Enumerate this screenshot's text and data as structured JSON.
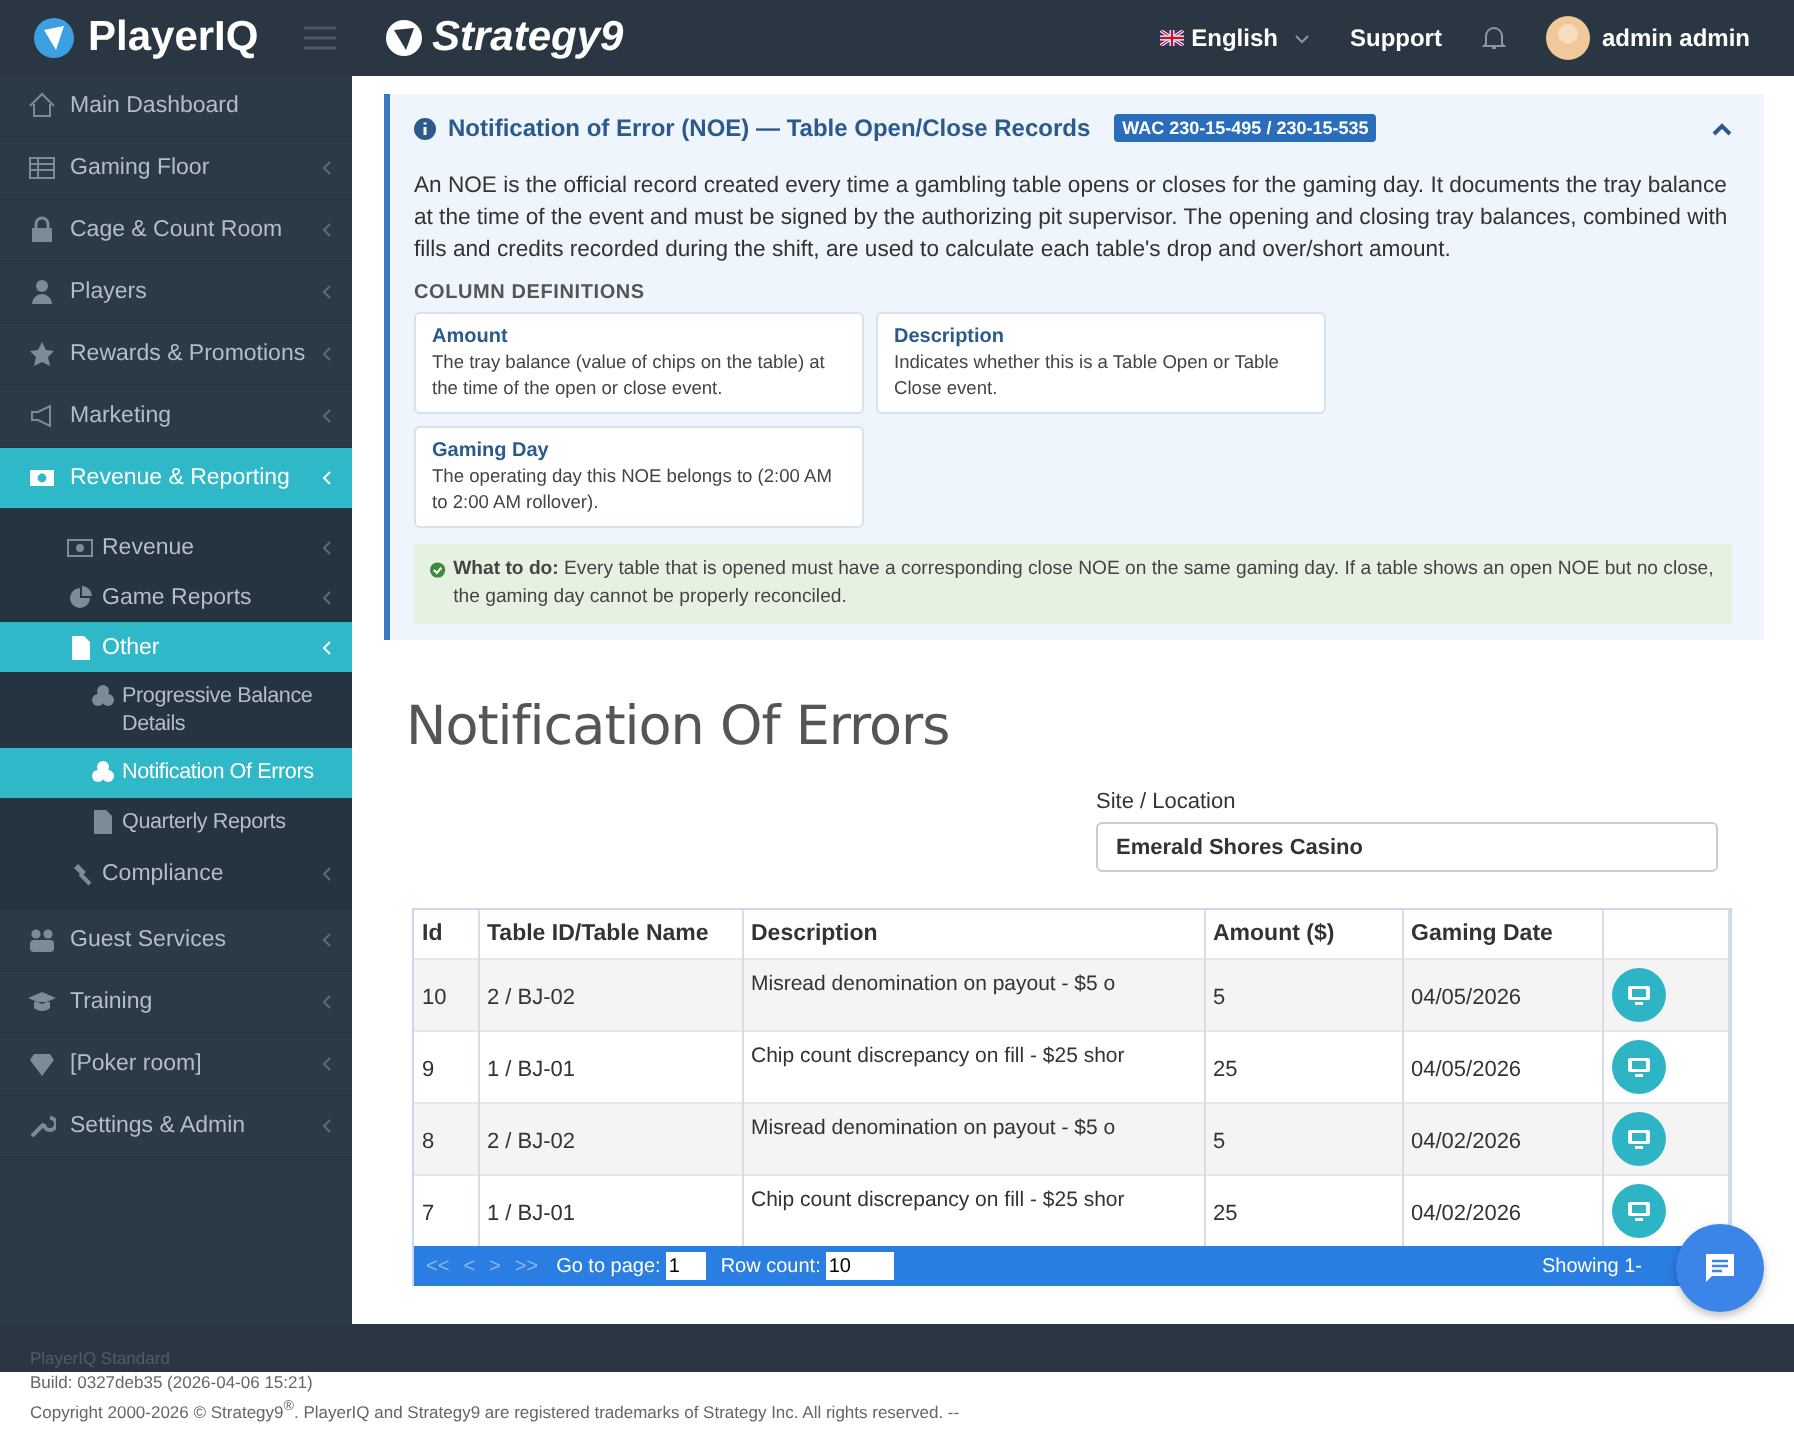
{
  "header": {
    "brand": "PlayerIQ",
    "company": "Strategy9",
    "language": "English",
    "support": "Support",
    "user": "admin admin"
  },
  "sidebar": {
    "items": [
      {
        "label": "Main Dashboard",
        "selected": false,
        "expandable": false
      },
      {
        "label": "Gaming Floor",
        "selected": false,
        "expandable": true
      },
      {
        "label": "Cage & Count Room",
        "selected": false,
        "expandable": true
      },
      {
        "label": "Players",
        "selected": false,
        "expandable": true
      },
      {
        "label": "Rewards & Promotions",
        "selected": false,
        "expandable": true
      },
      {
        "label": "Marketing",
        "selected": false,
        "expandable": true
      },
      {
        "label": "Revenue & Reporting",
        "selected": true,
        "expandable": true,
        "children": [
          {
            "label": "Revenue",
            "selected": false,
            "expandable": true
          },
          {
            "label": "Game Reports",
            "selected": false,
            "expandable": true
          },
          {
            "label": "Other",
            "selected": true,
            "expandable": true,
            "children": [
              {
                "label": "Progressive Balance Details",
                "selected": false,
                "expandable": false
              },
              {
                "label": "Notification Of Errors",
                "selected": true,
                "expandable": false
              },
              {
                "label": "Quarterly Reports",
                "selected": false,
                "expandable": false
              }
            ]
          },
          {
            "label": "Compliance",
            "selected": false,
            "expandable": true
          }
        ]
      },
      {
        "label": "Guest Services",
        "selected": false,
        "expandable": true
      },
      {
        "label": "Training",
        "selected": false,
        "expandable": true
      },
      {
        "label": "[Poker room]",
        "selected": false,
        "expandable": true
      },
      {
        "label": "Settings & Admin",
        "selected": false,
        "expandable": true
      }
    ]
  },
  "info": {
    "expanded": true,
    "title": "Notification of Error (NOE) — Table Open/Close Records",
    "badge": "WAC 230-15-495 / 230-15-535",
    "text": "An NOE is the official record created every time a gambling table opens or closes for the gaming day. It documents the tray balance at the time of the event and must be signed by the authorizing pit supervisor. The opening and closing tray balances, combined with fills and credits recorded during the shift, are used to calculate each table's drop and over/short amount.",
    "definitions_heading": "COLUMN DEFINITIONS",
    "definitions": [
      {
        "term": "Amount",
        "text": "The tray balance (value of chips on the table) at the time of the open or close event."
      },
      {
        "term": "Description",
        "text": "Indicates whether this is a Table Open or Table Close event."
      },
      {
        "term": "Gaming Day",
        "text": "The operating day this NOE belongs to (2:00 AM to 2:00 AM rollover)."
      }
    ],
    "what_to_do": "**What to do:** Every table that is opened must have a corresponding close NOE on the same gaming day. If a table shows an open NOE but no close, the gaming day cannot be properly reconciled."
  },
  "page_title": "Notification Of Errors",
  "filter": {
    "label": "Site / Location",
    "value": "Emerald Shores Casino"
  },
  "table": {
    "columns": [
      "Id",
      "Table ID/Table Name",
      "Description",
      "Amount ($)",
      "Gaming Date"
    ],
    "rows": [
      {
        "cells": [
          "10",
          "2 / BJ-02",
          "Misread denomination on payout - $5 o",
          "5",
          "04/05/2026"
        ]
      },
      {
        "cells": [
          "9",
          "1 / BJ-01",
          "Chip count discrepancy on fill - $25 shor",
          "25",
          "04/05/2026"
        ]
      },
      {
        "cells": [
          "8",
          "2 / BJ-02",
          "Misread denomination on payout - $5 o",
          "5",
          "04/02/2026"
        ]
      },
      {
        "cells": [
          "7",
          "1 / BJ-01",
          "Chip count discrepancy on fill - $25 shor",
          "25",
          "04/02/2026"
        ]
      }
    ]
  },
  "pager": {
    "nav": [
      {
        "label": "<<",
        "disabled": true
      },
      {
        "label": "<",
        "disabled": true
      },
      {
        "label": ">",
        "disabled": true
      },
      {
        "label": ">>",
        "disabled": true
      }
    ],
    "page_label": "Go to page:",
    "page": "1",
    "rows_label": "Row count:",
    "rows": "10",
    "showing": "Showing 1-"
  },
  "footer": {
    "edition": "PlayerIQ Standard",
    "build": "Build: 0327deb35 (2026-04-06 15:21)",
    "copyright": "Copyright 2000-2026 © Strategy9$^{®}$. PlayerIQ and Strategy9 are registered trademarks of Strategy Inc. All rights reserved. --"
  }
}
